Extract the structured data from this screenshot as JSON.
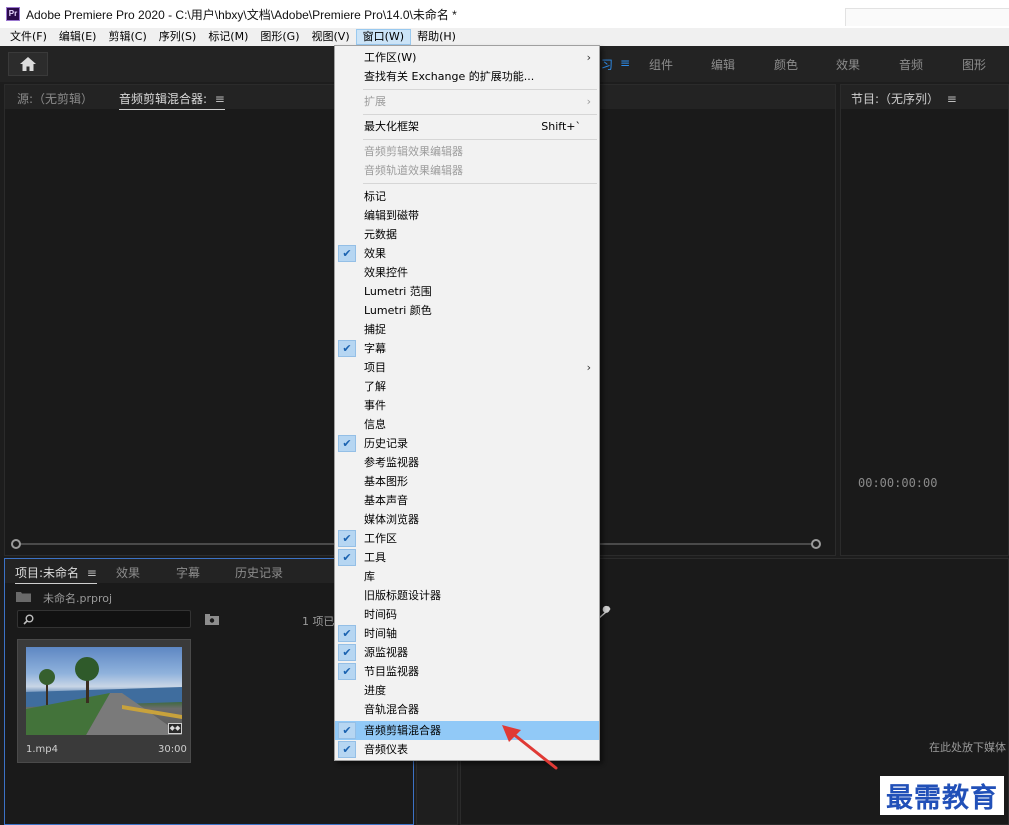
{
  "titlebar": {
    "logo": "Pr",
    "title": "Adobe Premiere Pro 2020 - C:\\用户\\hbxy\\文档\\Adobe\\Premiere Pro\\14.0\\未命名 *"
  },
  "menubar": {
    "items": [
      "文件(F)",
      "编辑(E)",
      "剪辑(C)",
      "序列(S)",
      "标记(M)",
      "图形(G)",
      "视图(V)",
      "窗口(W)",
      "帮助(H)"
    ]
  },
  "workspace_tabs": {
    "home_icon": "home-icon",
    "active_partial": "习",
    "items": [
      "组件",
      "编辑",
      "颜色",
      "效果",
      "音频",
      "图形"
    ]
  },
  "source_panel": {
    "tab_source": "源:（无剪辑）",
    "tab_mixer": "音频剪辑混合器:"
  },
  "program_panel": {
    "title": "节目:（无序列）",
    "timecode": "00:00:00:00"
  },
  "project_panel": {
    "tab_project": "项目:未命名",
    "tab_effects": "效果",
    "tab_captions": "字幕",
    "tab_history": "历史记录",
    "file_name": "未命名.prproj",
    "search_placeholder": "",
    "item_count": "1 项已",
    "clip_name": "1.mp4",
    "clip_duration": "30:00"
  },
  "timeline_panel": {
    "drop_hint": "在此处放下媒体"
  },
  "window_menu": {
    "items": [
      {
        "label": "工作区(W)",
        "submenu": true
      },
      {
        "label": "查找有关 Exchange 的扩展功能..."
      },
      {
        "label": "扩展",
        "submenu": true,
        "disabled": true
      },
      {
        "label": "最大化框架",
        "shortcut": "Shift+`"
      },
      {
        "label": "音频剪辑效果编辑器",
        "disabled": true
      },
      {
        "label": "音频轨道效果编辑器",
        "disabled": true
      },
      {
        "label": "标记"
      },
      {
        "label": "编辑到磁带"
      },
      {
        "label": "元数据"
      },
      {
        "label": "效果",
        "checked": true
      },
      {
        "label": "效果控件"
      },
      {
        "label": "Lumetri 范围"
      },
      {
        "label": "Lumetri 颜色"
      },
      {
        "label": "捕捉"
      },
      {
        "label": "字幕",
        "checked": true
      },
      {
        "label": "项目",
        "submenu": true
      },
      {
        "label": "了解"
      },
      {
        "label": "事件"
      },
      {
        "label": "信息"
      },
      {
        "label": "历史记录",
        "checked": true
      },
      {
        "label": "参考监视器"
      },
      {
        "label": "基本图形"
      },
      {
        "label": "基本声音"
      },
      {
        "label": "媒体浏览器"
      },
      {
        "label": "工作区",
        "checked": true
      },
      {
        "label": "工具",
        "checked": true
      },
      {
        "label": "库"
      },
      {
        "label": "旧版标题设计器"
      },
      {
        "label": "时间码"
      },
      {
        "label": "时间轴",
        "checked": true
      },
      {
        "label": "源监视器",
        "checked": true
      },
      {
        "label": "节目监视器",
        "checked": true
      },
      {
        "label": "进度"
      },
      {
        "label": "音轨混合器"
      },
      {
        "label": "音频剪辑混合器",
        "checked": true,
        "highlighted": true
      },
      {
        "label": "音频仪表",
        "checked": true
      }
    ]
  },
  "annotation": {
    "arrow_color": "#e03a35"
  },
  "watermark": {
    "text": "最需教育"
  },
  "colors": {
    "accent": "#2d8ceb",
    "menu_highlight": "#91c9f7",
    "check_box": "#b6d6f2"
  }
}
